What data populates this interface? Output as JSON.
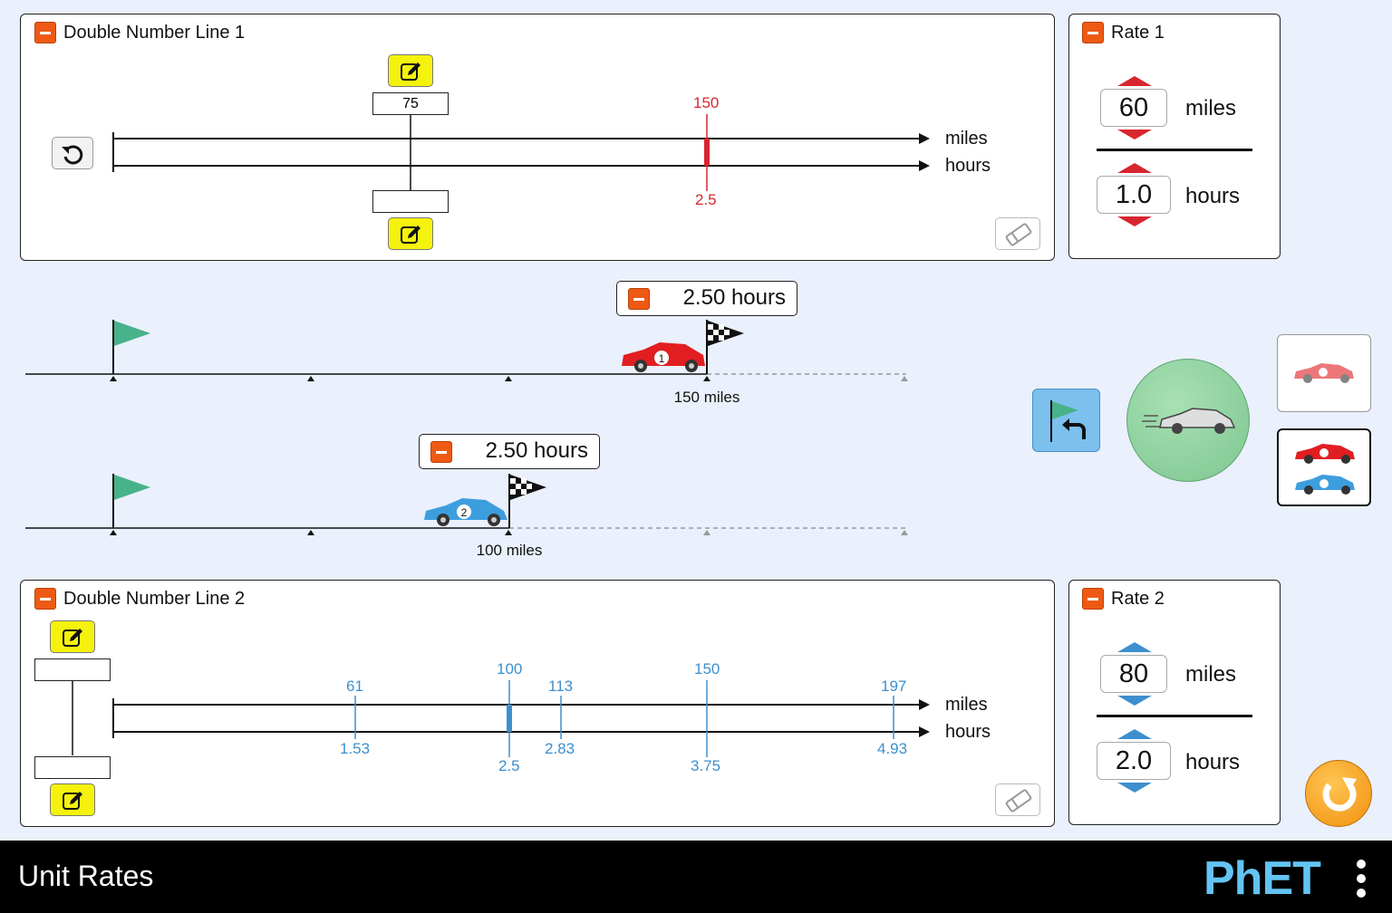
{
  "app": {
    "title": "Unit Rates",
    "logo_text": "PhET"
  },
  "colors": {
    "car1": "#e11e22",
    "car2": "#3d9ede",
    "dnl1_marker": "#d8262f",
    "dnl2_marker": "#3d8fce",
    "collapse": "#ee5a14",
    "edit_button": "#f5f20e"
  },
  "dnl1": {
    "title": "Double Number Line 1",
    "top_label": "miles",
    "bottom_label": "hours",
    "edit_top_value": "75",
    "edit_bottom_value": "",
    "markers": [
      {
        "top": "150",
        "bottom": "2.5"
      }
    ]
  },
  "rate1": {
    "title": "Rate 1",
    "numerator": "60",
    "numerator_unit": "miles",
    "denominator": "1.0",
    "denominator_unit": "hours"
  },
  "race": {
    "track1": {
      "timer": "2.50 hours",
      "finish_label": "150 miles"
    },
    "track2": {
      "timer": "2.50 hours",
      "finish_label": "100 miles"
    }
  },
  "dnl2": {
    "title": "Double Number Line 2",
    "top_label": "miles",
    "bottom_label": "hours",
    "edit_top_value": "",
    "edit_bottom_value": "",
    "markers": [
      {
        "top": "61",
        "bottom": "1.53"
      },
      {
        "top": "100",
        "bottom": "2.5"
      },
      {
        "top": "113",
        "bottom": "2.83"
      },
      {
        "top": "150",
        "bottom": "3.75"
      },
      {
        "top": "197",
        "bottom": "4.93"
      }
    ]
  },
  "rate2": {
    "title": "Rate 2",
    "numerator": "80",
    "numerator_unit": "miles",
    "denominator": "2.0",
    "denominator_unit": "hours"
  },
  "icons": [
    "collapse-icon",
    "edit-icon",
    "eraser-icon",
    "undo-icon",
    "start-flag-icon",
    "checkered-flag-icon",
    "reset-race-icon",
    "go-car-icon",
    "reset-all-icon",
    "menu-icon"
  ]
}
